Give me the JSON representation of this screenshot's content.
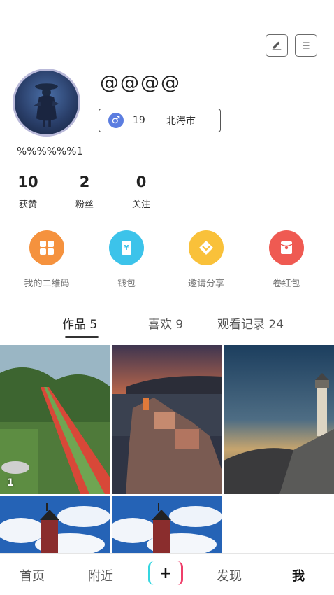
{
  "header": {
    "edit_icon": "pencil-icon",
    "menu_icon": "menu-icon"
  },
  "profile": {
    "nickname": "@@@@",
    "gender_symbol": "♂",
    "age": "19",
    "city": "北海市",
    "signature": "%%%%%%1"
  },
  "stats": [
    {
      "value": "10",
      "label": "获赞"
    },
    {
      "value": "2",
      "label": "粉丝"
    },
    {
      "value": "0",
      "label": "关注"
    }
  ],
  "shortcuts": [
    {
      "label": "我的二维码",
      "icon": "qrcode-icon",
      "color": "#f5923e"
    },
    {
      "label": "钱包",
      "icon": "wallet-icon",
      "color": "#3cc3ea"
    },
    {
      "label": "邀请分享",
      "icon": "share-icon",
      "color": "#f9c13a"
    },
    {
      "label": "卷红包",
      "icon": "red-envelope-icon",
      "color": "#ef5a52"
    }
  ],
  "tabs": [
    {
      "label": "作品 5",
      "active": true
    },
    {
      "label": "喜欢 9",
      "active": false
    },
    {
      "label": "观看记录 24",
      "active": false
    }
  ],
  "grid": {
    "first_badge": "1"
  },
  "bottom_nav": {
    "home": "首页",
    "nearby": "附近",
    "plus": "+",
    "discover": "发现",
    "me": "我"
  }
}
